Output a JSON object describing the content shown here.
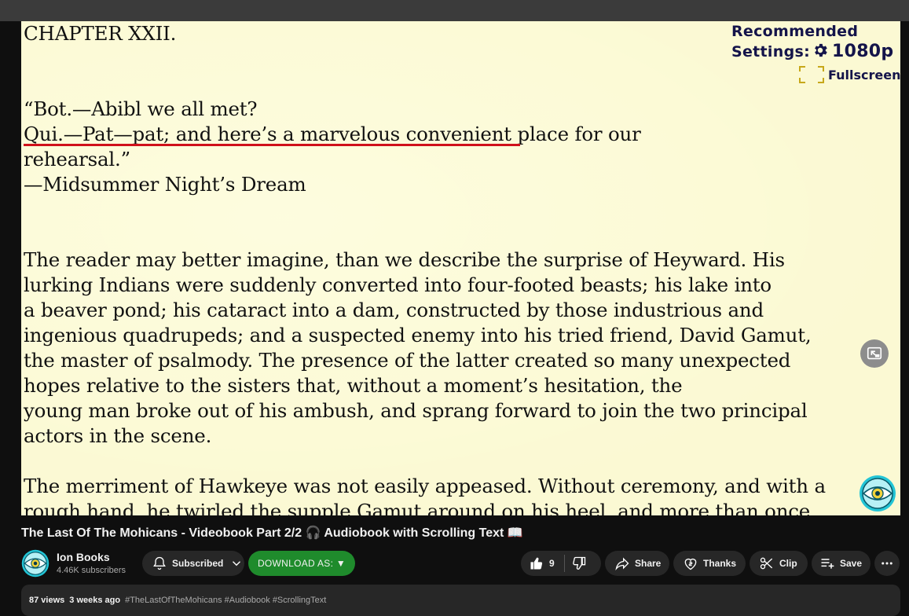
{
  "book": {
    "chapter": "CHAPTER XXII.",
    "epigraph_lines": [
      "“Bot.—Abibl we all met?",
      "Qui.—Pat—pat; and here’s a marvelous convenient place for our",
      "rehearsal.”",
      "—Midsummer Night’s Dream"
    ],
    "paragraph1_lines": [
      "The reader may better imagine, than we describe the surprise of Heyward. His",
      "lurking Indians were suddenly converted into four-footed beasts; his lake into",
      "a beaver pond; his cataract into a dam, constructed by those industrious and",
      "ingenious quadrupeds; and a suspected enemy into his tried friend, David Gamut,",
      "the master of psalmody. The presence of the latter created so many unexpected",
      "hopes relative to the sisters that, without a moment’s hesitation, the",
      "young man broke out of his ambush, and sprang forward to join the two principal",
      "actors in the scene."
    ],
    "paragraph2_lines": [
      "The merriment of Hawkeye was not easily appeased. Without ceremony, and with a",
      "rough hand, he twirled the supple Gamut around on his heel, and more than once"
    ]
  },
  "overlay": {
    "recommended": "Recommended",
    "settings_label": "Settings:",
    "resolution": "1080p",
    "fullscreen": "Fullscreen"
  },
  "video": {
    "title": "The Last Of The Mohicans - Videobook Part 2/2 🎧 Audiobook with Scrolling Text 📖"
  },
  "channel": {
    "name": "Ion Books",
    "subscribers": "4.46K subscribers"
  },
  "actions": {
    "subscribed": "Subscribed",
    "download": "DOWNLOAD AS: ▼",
    "like_count": "9",
    "share": "Share",
    "thanks": "Thanks",
    "clip": "Clip",
    "save": "Save"
  },
  "description": {
    "views": "87 views",
    "date": "3 weeks ago",
    "tags": "#TheLastOfTheMohicans #Audiobook #ScrollingText"
  },
  "colors": {
    "page_bg": "#0f0f0f",
    "player_bg": "#fbf9d3",
    "underline": "#d0101a",
    "download_green": "#1f8b2c",
    "overlay_text": "#14144a"
  }
}
